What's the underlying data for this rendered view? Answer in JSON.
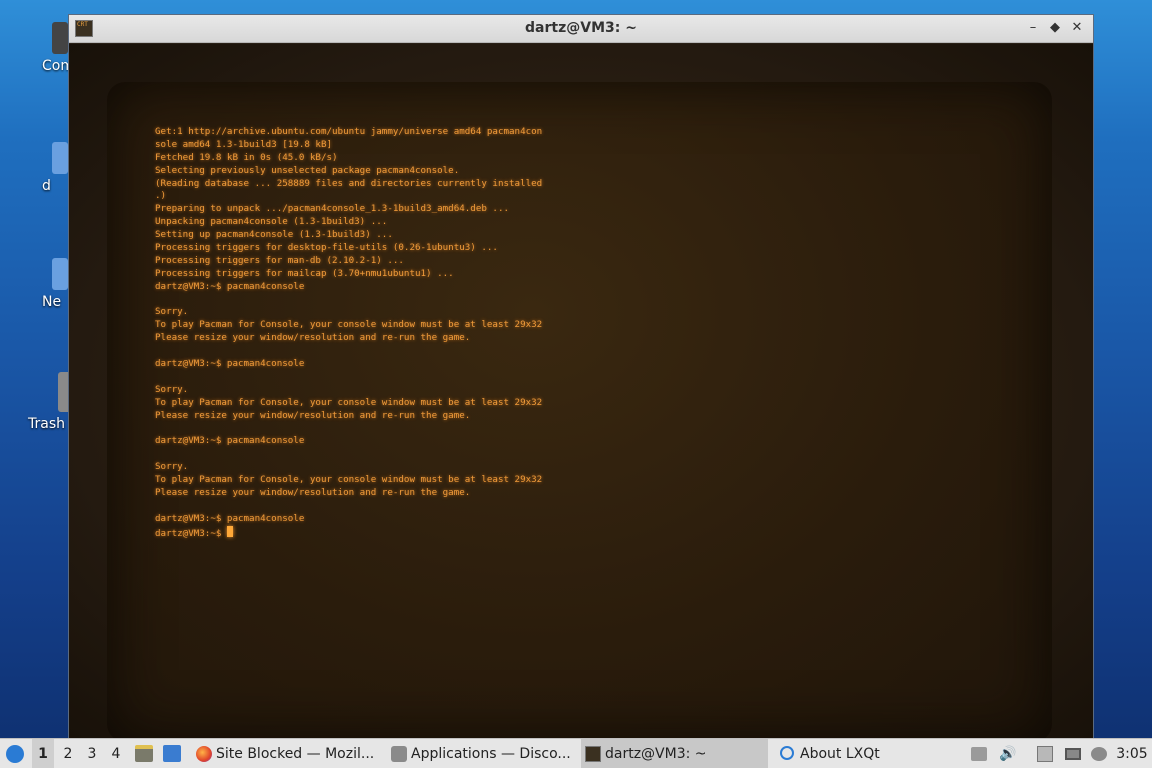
{
  "desktop": {
    "icons": [
      {
        "label": "Com"
      },
      {
        "label": "d"
      },
      {
        "label": "Ne"
      },
      {
        "label": "Trash"
      }
    ]
  },
  "window": {
    "title": "dartz@VM3: ~",
    "app_icon_text": "CRT",
    "controls": {
      "minimize": "–",
      "maximize": "◆",
      "close": "✕"
    }
  },
  "terminal": {
    "lines": [
      "Get:1 http://archive.ubuntu.com/ubuntu jammy/universe amd64 pacman4con",
      "sole amd64 1.3-1build3 [19.8 kB]",
      "Fetched 19.8 kB in 0s (45.0 kB/s)",
      "Selecting previously unselected package pacman4console.",
      "(Reading database ... 258889 files and directories currently installed",
      ".)",
      "Preparing to unpack .../pacman4console_1.3-1build3_amd64.deb ...",
      "Unpacking pacman4console (1.3-1build3) ...",
      "Setting up pacman4console (1.3-1build3) ...",
      "Processing triggers for desktop-file-utils (0.26-1ubuntu3) ...",
      "Processing triggers for man-db (2.10.2-1) ...",
      "Processing triggers for mailcap (3.70+nmu1ubuntu1) ...",
      "dartz@VM3:~$ pacman4console",
      "",
      "Sorry.",
      "To play Pacman for Console, your console window must be at least 29x32",
      "Please resize your window/resolution and re-run the game.",
      "",
      "dartz@VM3:~$ pacman4console",
      "",
      "Sorry.",
      "To play Pacman for Console, your console window must be at least 29x32",
      "Please resize your window/resolution and re-run the game.",
      "",
      "dartz@VM3:~$ pacman4console",
      "",
      "Sorry.",
      "To play Pacman for Console, your console window must be at least 29x32",
      "Please resize your window/resolution and re-run the game.",
      "",
      "dartz@VM3:~$ pacman4console"
    ],
    "prompt": "dartz@VM3:~$ ",
    "text_color": "#ee9a3a"
  },
  "taskbar": {
    "workspaces": [
      "1",
      "2",
      "3",
      "4"
    ],
    "tasks": [
      {
        "label": "Site Blocked — Mozil...",
        "icon": "firefox-icon"
      },
      {
        "label": "Applications — Disco...",
        "icon": "discover-icon"
      },
      {
        "label": "dartz@VM3: ~",
        "icon": "terminal-icon"
      },
      {
        "label": "About LXQt",
        "icon": "lxqt-icon"
      }
    ],
    "volume_glyph": "🔊",
    "clock": "3:05"
  }
}
